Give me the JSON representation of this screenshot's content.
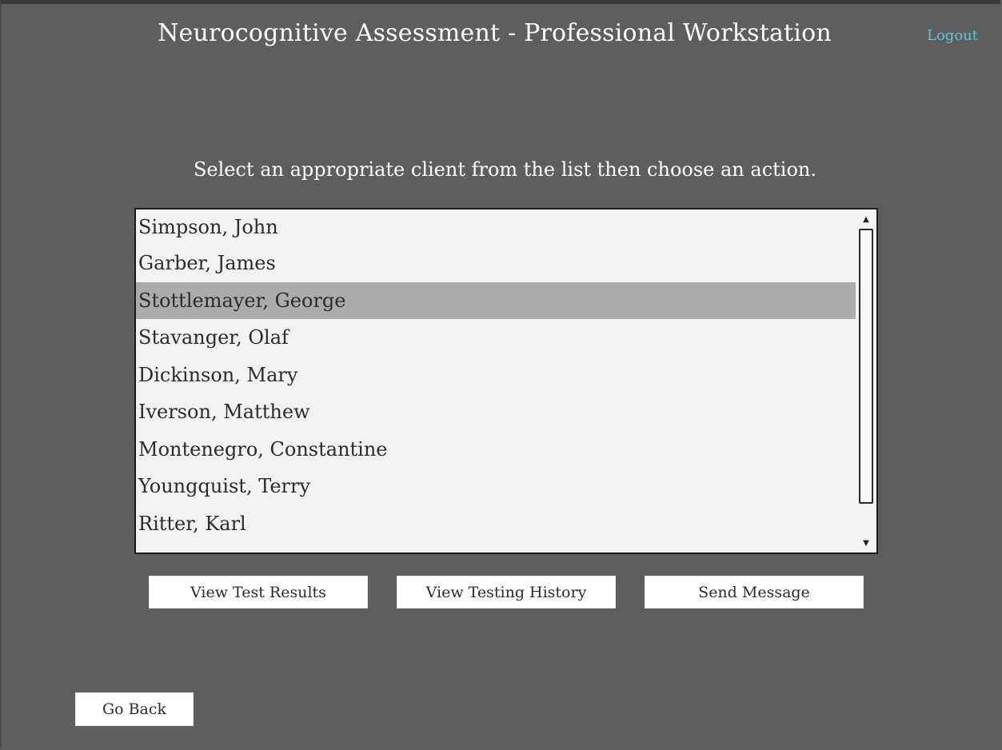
{
  "header": {
    "title": "Neurocognitive Assessment - Professional Workstation",
    "logout_label": "Logout"
  },
  "instruction": "Select an appropriate client from the list then choose an action.",
  "client_list": {
    "items": [
      {
        "label": "Simpson, John",
        "selected": false
      },
      {
        "label": "Garber, James",
        "selected": false
      },
      {
        "label": "Stottlemayer, George",
        "selected": true
      },
      {
        "label": "Stavanger, Olaf",
        "selected": false
      },
      {
        "label": "Dickinson, Mary",
        "selected": false
      },
      {
        "label": "Iverson, Matthew",
        "selected": false
      },
      {
        "label": "Montenegro, Constantine",
        "selected": false
      },
      {
        "label": "Youngquist, Terry",
        "selected": false
      },
      {
        "label": "Ritter, Karl",
        "selected": false
      }
    ],
    "scroll_up_icon": "▲",
    "scroll_down_icon": "▼"
  },
  "actions": {
    "view_test_results": "View Test Results",
    "view_testing_history": "View Testing History",
    "send_message": "Send Message"
  },
  "footer": {
    "go_back_label": "Go Back"
  },
  "colors": {
    "background": "#5e5e5e",
    "logout_link": "#5fc4d8",
    "list_background": "#f2f2f2",
    "selected_row": "#ababab",
    "button_background": "#ffffff"
  }
}
